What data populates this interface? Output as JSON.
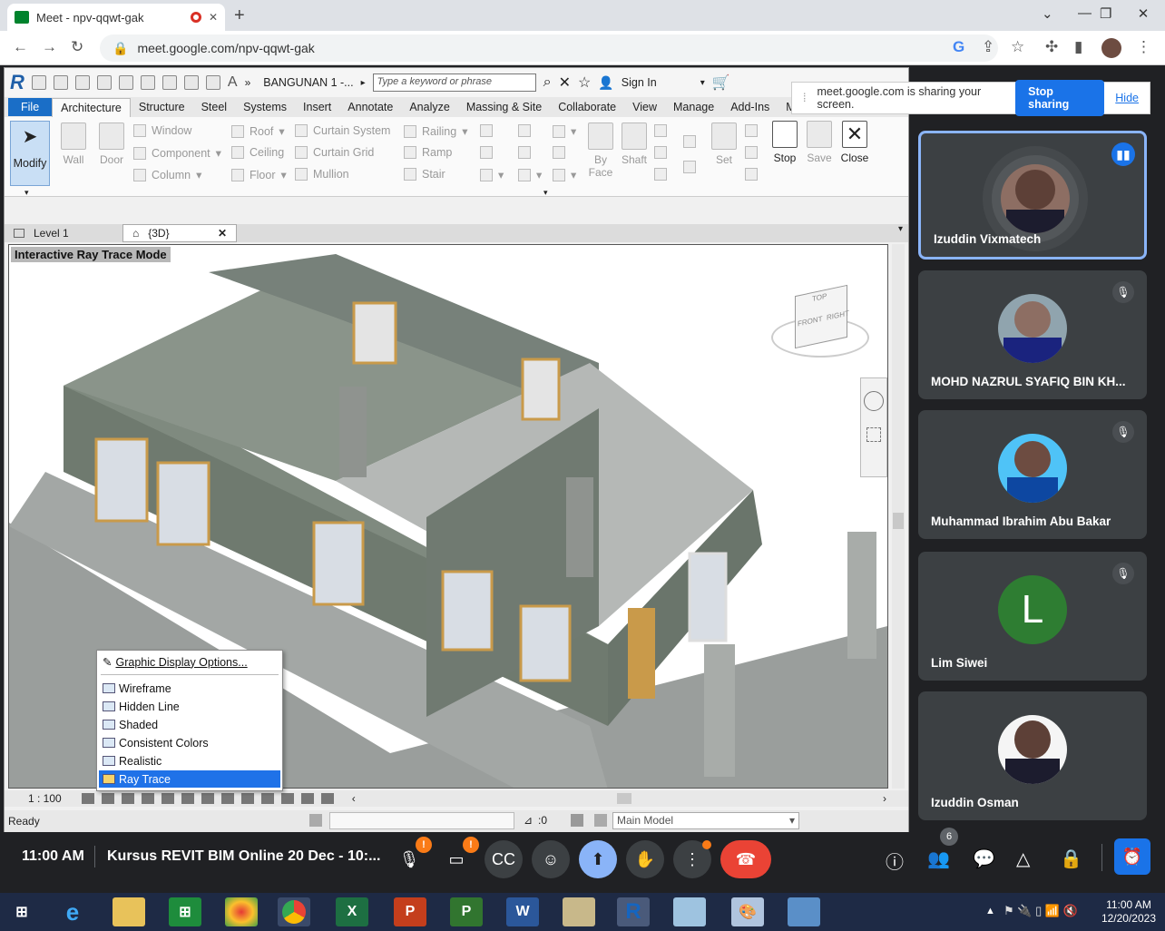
{
  "browser": {
    "tab_title": "Meet - npv-qqwt-gak",
    "url": "meet.google.com/npv-qqwt-gak",
    "close_tab": "✕",
    "new_tab": "+",
    "win_controls": [
      "⌄",
      "—",
      "❐",
      "✕"
    ]
  },
  "revit": {
    "project_title": "BANGUNAN 1 -...",
    "search_placeholder": "Type a keyword or phrase",
    "sign_in": "Sign In",
    "menu_tabs": [
      "File",
      "Architecture",
      "Structure",
      "Steel",
      "Systems",
      "Insert",
      "Annotate",
      "Analyze",
      "Massing & Site",
      "Collaborate",
      "View",
      "Manage",
      "Add-Ins",
      "Mo"
    ],
    "ribbon": {
      "modify": "Modify",
      "wall": "Wall",
      "door": "Door",
      "window": "Window",
      "component": "Component",
      "column": "Column",
      "roof": "Roof",
      "ceiling": "Ceiling",
      "floor": "Floor",
      "curtain_system": "Curtain System",
      "curtain_grid": "Curtain Grid",
      "mullion": "Mullion",
      "railing": "Railing",
      "ramp": "Ramp",
      "stair": "Stair",
      "by_face": "By\nFace",
      "shaft": "Shaft",
      "set": "Set",
      "stop": "Stop",
      "save": "Save",
      "close": "Close"
    },
    "view_tabs": [
      {
        "label": "Level 1"
      },
      {
        "label": "{3D}"
      }
    ],
    "viewport_label": "Interactive Ray Trace Mode",
    "scale": "1 : 100",
    "status": "Ready",
    "model_selector": "Main Model",
    "counter": ":0",
    "context_menu": [
      "Graphic Display Options...",
      "Wireframe",
      "Hidden Line",
      "Shaded",
      "Consistent Colors",
      "Realistic",
      "Ray Trace"
    ],
    "viewcube": {
      "top": "TOP",
      "front": "FRONT",
      "right": "RIGHT"
    }
  },
  "share_bar": {
    "message": "meet.google.com is sharing your screen.",
    "stop": "Stop sharing",
    "hide": "Hide"
  },
  "participants": [
    {
      "name": "Izuddin Vixmatech",
      "speaking": true
    },
    {
      "name": "MOHD NAZRUL SYAFIQ BIN KH...",
      "muted": true
    },
    {
      "name": "Muhammad Ibrahim Abu Bakar",
      "muted": true
    },
    {
      "name": "Lim Siwei",
      "muted": true,
      "initial": "L"
    },
    {
      "name": "Izuddin Osman",
      "muted": false
    }
  ],
  "meet": {
    "time": "11:00 AM",
    "meeting_title": "Kursus REVIT BIM Online 20 Dec - 10:...",
    "people_count": "6",
    "alert_badge": "!"
  },
  "taskbar": {
    "time": "11:00 AM",
    "date": "12/20/2023"
  },
  "colors": {
    "revit_blue": "#1a6ec7",
    "meet_bg": "#202124",
    "hangup": "#ea4335",
    "present_active": "#8ab4f8",
    "avatar_L": "#2e7d32"
  }
}
